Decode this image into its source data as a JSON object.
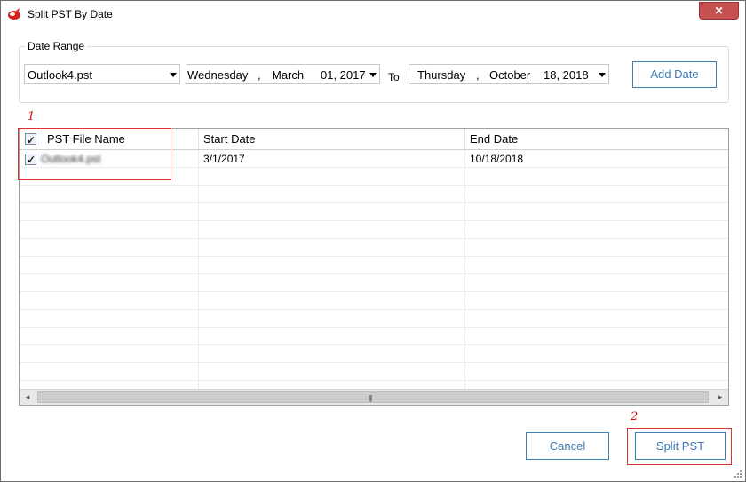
{
  "window": {
    "title": "Split PST By Date",
    "close_label": "✕"
  },
  "date_range": {
    "legend": "Date Range",
    "pst_select": "Outlook4.pst",
    "from": {
      "day": "Wednesday",
      "comma": ",",
      "month": "March",
      "date": "01, 2017"
    },
    "to_label": "To",
    "to": {
      "day": "Thursday",
      "comma": ",",
      "month": "October",
      "date": "18, 2018"
    },
    "add_button": "Add Date"
  },
  "annotations": {
    "one": "1",
    "two": "2"
  },
  "grid": {
    "columns": [
      "PST File Name",
      "Start Date",
      "End Date"
    ],
    "rows": [
      {
        "file": "Outlook4.pst",
        "start": "3/1/2017",
        "end": "10/18/2018",
        "checked": true
      }
    ],
    "header_checked": true
  },
  "buttons": {
    "cancel": "Cancel",
    "split": "Split PST"
  },
  "colors": {
    "accent": "#3c7fb1",
    "annotation": "#dd2222",
    "close": "#c75050"
  }
}
